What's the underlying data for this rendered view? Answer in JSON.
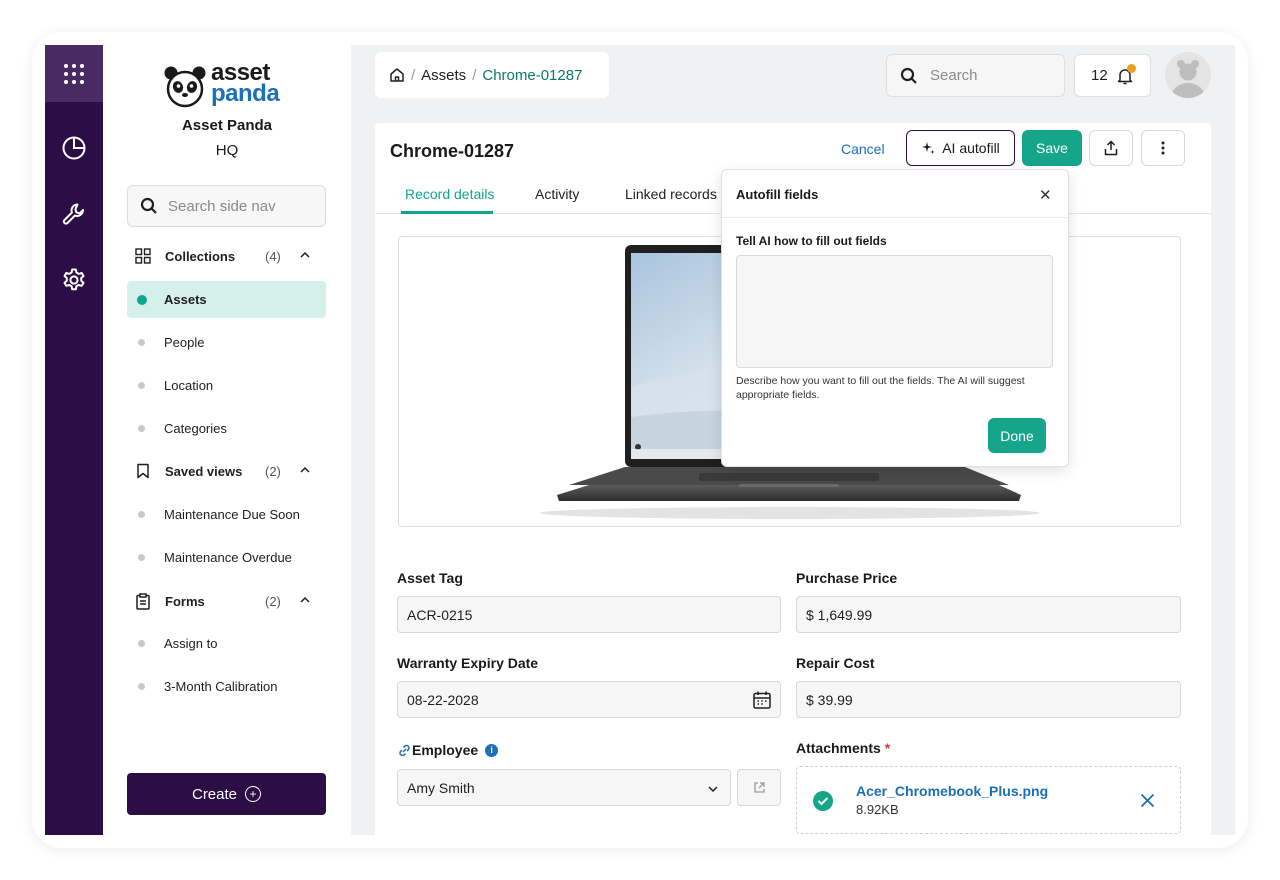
{
  "app": {
    "brand": {
      "line1": "asset",
      "line2": "panda"
    },
    "org_name": "Asset Panda",
    "org_location": "HQ"
  },
  "rail": {
    "icons": [
      "apps-grid-icon",
      "pie-chart-icon",
      "wrench-icon",
      "gear-icon"
    ]
  },
  "sidebar": {
    "search_placeholder": "Search side nav",
    "sections": [
      {
        "label": "Collections",
        "count": "(4)",
        "items": [
          "Assets",
          "People",
          "Location",
          "Categories"
        ]
      },
      {
        "label": "Saved views",
        "count": "(2)",
        "items": [
          "Maintenance Due Soon",
          "Maintenance Overdue"
        ]
      },
      {
        "label": "Forms",
        "count": "(2)",
        "items": [
          "Assign to",
          "3-Month Calibration"
        ]
      }
    ],
    "create_label": "Create"
  },
  "header": {
    "breadcrumb": [
      "Assets",
      "Chrome-01287"
    ],
    "search_placeholder": "Search",
    "notification_count": "12"
  },
  "record": {
    "title": "Chrome-01287",
    "actions": {
      "cancel": "Cancel",
      "ai_autofill": "AI autofill",
      "save": "Save"
    },
    "tabs": [
      "Record details",
      "Activity",
      "Linked records"
    ],
    "active_tab": "Record details",
    "fields": {
      "asset_tag": {
        "label": "Asset Tag",
        "value": "ACR-0215"
      },
      "purchase_price": {
        "label": "Purchase Price",
        "value": "$ 1,649.99"
      },
      "warranty_expiry": {
        "label": "Warranty Expiry Date",
        "value": "08-22-2028"
      },
      "repair_cost": {
        "label": "Repair Cost",
        "value": "$ 39.99"
      },
      "employee": {
        "label": "Employee",
        "value": "Amy Smith"
      },
      "attachments": {
        "label": "Attachments",
        "required_mark": "*",
        "file_name": "Acer_Chromebook_Plus.png",
        "file_size": "8.92KB"
      }
    }
  },
  "autofill_popover": {
    "title": "Autofill fields",
    "prompt_label": "Tell AI how to fill out fields",
    "textarea_value": "",
    "help_text": "Describe how you want to fill out the fields. The AI will suggest appropriate fields.",
    "done_label": "Done"
  },
  "colors": {
    "rail": "#2d0d45",
    "accent_green": "#15a58b",
    "active_nav_bg": "#d5f0ea",
    "link_blue": "#1c6fb8",
    "notification_badge": "#e8a020"
  }
}
